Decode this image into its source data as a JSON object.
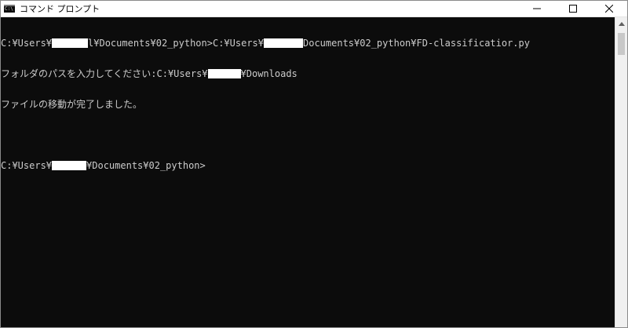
{
  "window": {
    "title": "コマンド プロンプト",
    "icon_text": "C:\\"
  },
  "controls": {
    "minimize": "minimize-icon",
    "maximize": "maximize-icon",
    "close": "close-icon"
  },
  "console": {
    "line1": {
      "a": "C:¥Users¥",
      "b": "l¥Documents¥02_python>C:¥Users¥",
      "c": "Documents¥02_python¥FD-classificatior.py"
    },
    "line2": {
      "a": "フォルダのパスを入力してください:C:¥Users¥",
      "b": "¥Downloads"
    },
    "line3": "ファイルの移動が完了しました。",
    "line4": "",
    "line5": {
      "a": "C:¥Users¥",
      "b": "¥Documents¥02_python>"
    }
  },
  "colors": {
    "console_bg": "#0c0c0c",
    "console_text": "#cccccc",
    "titlebar_bg": "#ffffff"
  }
}
